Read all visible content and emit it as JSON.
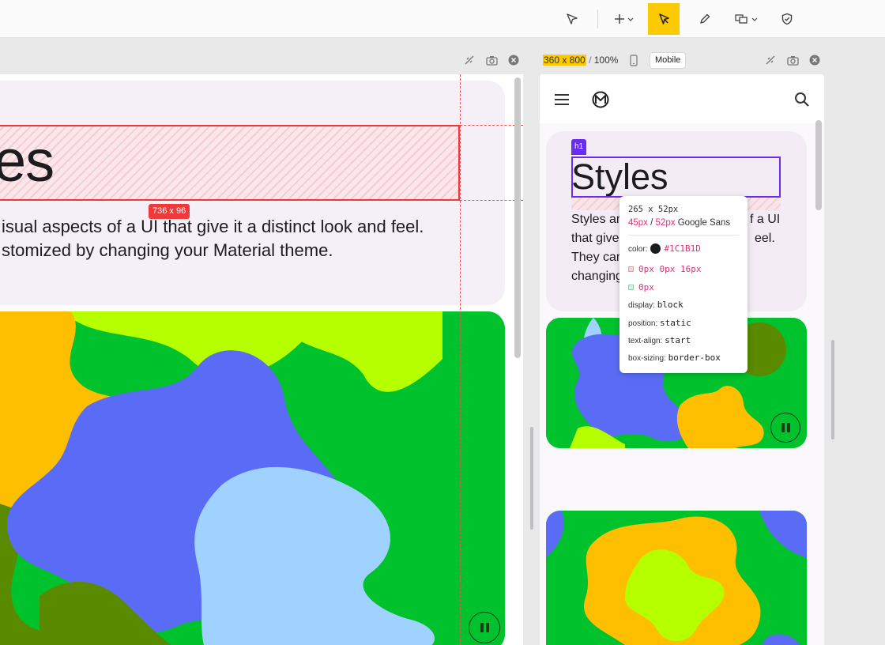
{
  "toolbar": {
    "icons": [
      "select-cursor-icon",
      "add-icon",
      "inspect-pointer-icon",
      "pen-icon",
      "comment-icon",
      "shield-check-icon"
    ],
    "active": "inspect-pointer-icon"
  },
  "left_pane": {
    "heading_text": "es",
    "size_badge": "736 x 96",
    "body_line1": "isual aspects of a UI that give it a distinct look and feel.",
    "body_line2": "stomized by changing your Material theme."
  },
  "right_pane": {
    "viewport_size": "360 x 800",
    "separator": "/",
    "zoom": "100%",
    "device_label": "Mobile",
    "tag_label": "h1",
    "heading": "Styles",
    "body_line1": "Styles ar",
    "body_line1_end": "f a UI",
    "body_line2": "that give",
    "body_line2_end": "eel.",
    "body_line3": "They car",
    "body_line4": "changing"
  },
  "inspector": {
    "size": "265 x 52px",
    "font_size": "45px",
    "slash": "/",
    "line_height": "52px",
    "font_family": "Google Sans",
    "color_label": "color:",
    "color_value": "#1C1B1D",
    "margin": "0px 0px 16px",
    "padding": "0px",
    "display_label": "display:",
    "display_value": "block",
    "position_label": "position:",
    "position_value": "static",
    "text_align_label": "text-align:",
    "text_align_value": "start",
    "box_sizing_label": "box-sizing:",
    "box_sizing_value": "border-box"
  },
  "colors": {
    "accent": "#FDC901",
    "highlight_red": "#F03A3A",
    "highlight_purple": "#6A2CF0",
    "text": "#1C1B1D",
    "blob_green": "#00C22C",
    "blob_lime": "#B5FF00",
    "blob_orange": "#FDBF00",
    "blob_blue": "#5A6CF5",
    "blob_light_blue": "#A0D2FF",
    "blob_olive": "#5A8A00"
  }
}
